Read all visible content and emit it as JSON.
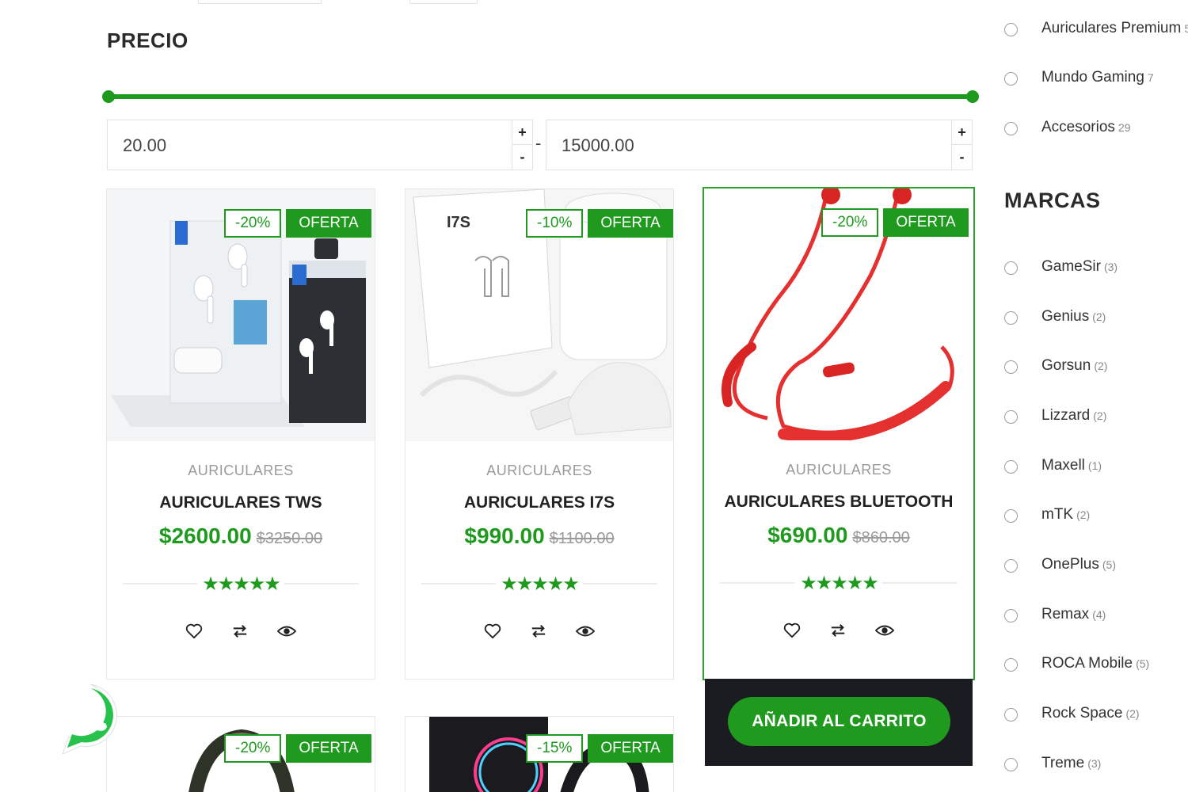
{
  "price_filter": {
    "title": "PRECIO",
    "min_value": "20.00",
    "max_value": "15000.00",
    "separator": "-",
    "plus": "+",
    "minus": "-"
  },
  "products": [
    {
      "discount": "-20%",
      "tag": "OFERTA",
      "category": "AURICULARES",
      "name": "AURICULARES TWS",
      "price": "$2600.00",
      "old_price": "$3250.00",
      "rating": 5,
      "stars": "★★★★★"
    },
    {
      "discount": "-10%",
      "tag": "OFERTA",
      "category": "AURICULARES",
      "name": "AURICULARES I7S",
      "price": "$990.00",
      "old_price": "$1100.00",
      "rating": 5,
      "stars": "★★★★★"
    },
    {
      "discount": "-20%",
      "tag": "OFERTA",
      "category": "AURICULARES",
      "name": "AURICULARES BLUETOOTH",
      "price": "$690.00",
      "old_price": "$860.00",
      "rating": 5,
      "stars": "★★★★★"
    },
    {
      "discount": "-20%",
      "tag": "OFERTA"
    },
    {
      "discount": "-15%",
      "tag": "OFERTA"
    }
  ],
  "add_to_cart": "AÑADIR AL CARRITO",
  "categories": [
    {
      "label": "Auriculares Premium",
      "count": "5"
    },
    {
      "label": "Mundo Gaming",
      "count": "7"
    },
    {
      "label": "Accesorios",
      "count": "29"
    }
  ],
  "brands_title": "MARCAS",
  "brands": [
    {
      "label": "GameSir",
      "count": "(3)"
    },
    {
      "label": "Genius",
      "count": "(2)"
    },
    {
      "label": "Gorsun",
      "count": "(2)"
    },
    {
      "label": "Lizzard",
      "count": "(2)"
    },
    {
      "label": "Maxell",
      "count": "(1)"
    },
    {
      "label": "mTK",
      "count": "(2)"
    },
    {
      "label": "OnePlus",
      "count": "(5)"
    },
    {
      "label": "Remax",
      "count": "(4)"
    },
    {
      "label": "ROCA Mobile",
      "count": "(5)"
    },
    {
      "label": "Rock Space",
      "count": "(2)"
    },
    {
      "label": "Treme",
      "count": "(3)"
    }
  ],
  "colors": {
    "accent": "#1f9a1f",
    "dark_bar": "#1a1c22",
    "muted": "#9a9a9a"
  }
}
